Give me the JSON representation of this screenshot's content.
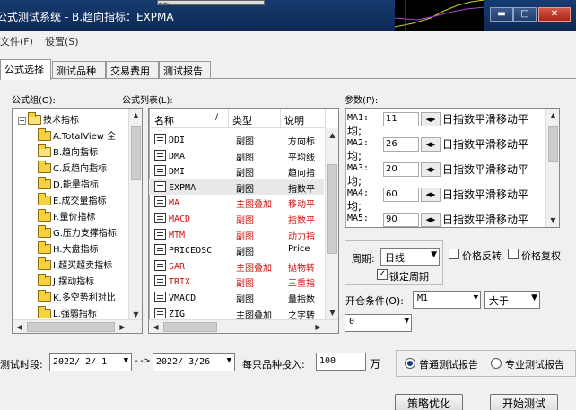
{
  "window": {
    "title": "公式测试系统 - B.趋向指标：EXPMA",
    "bg_scrap": "参数"
  },
  "menu": [
    "文件(F)",
    "设置(S)"
  ],
  "tabs": [
    "公式选择",
    "测试品种",
    "交易费用",
    "测试报告"
  ],
  "formula_group": {
    "label": "公式组(G):",
    "root": "技术指标",
    "items": [
      "A.TotalView 全",
      "B.趋向指标",
      "C.反趋向指标",
      "D.能量指标",
      "E.成交量指标",
      "F.量价指标",
      "G.压力支撑指标",
      "H.大盘指标",
      "I.超买超卖指标",
      "J.摆动指标",
      "K.多空势利对比",
      "L.强弱指标"
    ]
  },
  "formula_list": {
    "label": "公式列表(L):",
    "columns": [
      "名称",
      "类型",
      "说明"
    ],
    "rows": [
      {
        "name": "DDI",
        "type": "副图",
        "desc": "方向标",
        "red": false
      },
      {
        "name": "DMA",
        "type": "副图",
        "desc": "平均线",
        "red": false
      },
      {
        "name": "DMI",
        "type": "副图",
        "desc": "趋向指",
        "red": false
      },
      {
        "name": "EXPMA",
        "type": "副图",
        "desc": "指数平",
        "red": false
      },
      {
        "name": "MA",
        "type": "主图叠加",
        "desc": "移动平",
        "red": true
      },
      {
        "name": "MACD",
        "type": "副图",
        "desc": "指数平",
        "red": true
      },
      {
        "name": "MTM",
        "type": "副图",
        "desc": "动力指",
        "red": true
      },
      {
        "name": "PRICEOSC",
        "type": "副图",
        "desc": "Price",
        "red": false
      },
      {
        "name": "SAR",
        "type": "主图叠加",
        "desc": "抛物转",
        "red": true
      },
      {
        "name": "TRIX",
        "type": "副图",
        "desc": "三重指",
        "red": true
      },
      {
        "name": "VMACD",
        "type": "副图",
        "desc": "量指数",
        "red": false
      },
      {
        "name": "ZIG",
        "type": "主图叠加",
        "desc": "之字转",
        "red": false
      }
    ],
    "selected_index": 3
  },
  "params": {
    "label": "参数(P):",
    "rows": [
      {
        "name": "MA1:",
        "value": "11",
        "desc": "日指数平滑移动平",
        "desc2": "均;"
      },
      {
        "name": "MA2:",
        "value": "26",
        "desc": "日指数平滑移动平",
        "desc2": "均;"
      },
      {
        "name": "MA3:",
        "value": "20",
        "desc": "日指数平滑移动平",
        "desc2": "均;"
      },
      {
        "name": "MA4:",
        "value": "60",
        "desc": "日指数平滑移动平",
        "desc2": "均;"
      },
      {
        "name": "MA5:",
        "value": "90",
        "desc": "日指数平滑移动平",
        "desc2": ""
      }
    ]
  },
  "period": {
    "label": "周期:",
    "value": "日线",
    "lock_label": "锁定周期",
    "lock_checked": true
  },
  "price_reverse": {
    "label": "价格反转",
    "checked": false
  },
  "price_restore": {
    "label": "价格复权",
    "checked": false
  },
  "open_cond": {
    "label": "开仓条件(O):",
    "indicator": "M1",
    "operator": "大于",
    "value": "0"
  },
  "bottom": {
    "period_label": "测试时段:",
    "start": "2022/ 2/ 1",
    "arrow": "-->",
    "end": "2022/ 3/26",
    "invest_label": "每只品种投入:",
    "invest_value": "100",
    "invest_unit": "万",
    "report_normal": "普通测试报告",
    "report_pro": "专业测试报告",
    "report_selected": "normal"
  },
  "buttons": {
    "optimize": "策略优化",
    "start": "开始测试"
  }
}
